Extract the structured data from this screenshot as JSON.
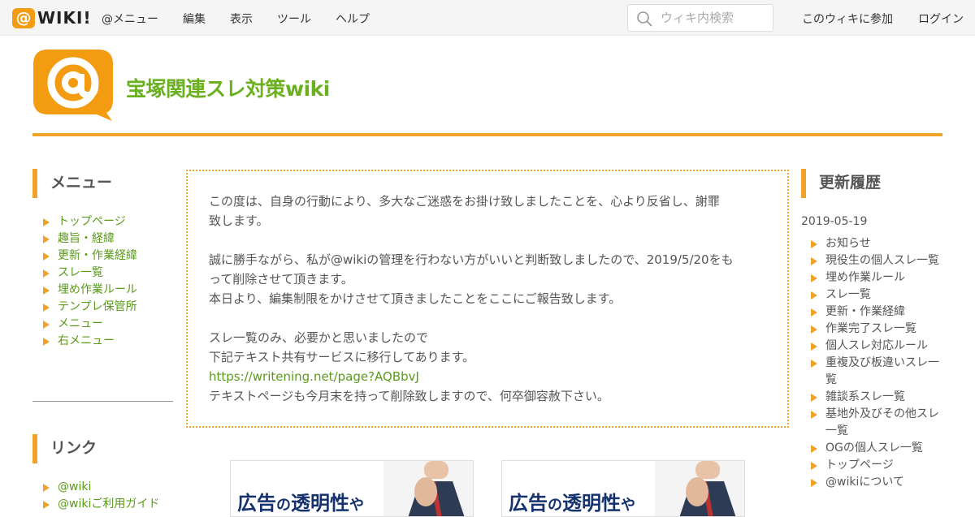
{
  "topnav": {
    "logo_text": "WIKI!",
    "items": [
      "@メニュー",
      "編集",
      "表示",
      "ツール",
      "ヘルプ"
    ],
    "search_placeholder": "ウィキ内検索",
    "join": "このウィキに参加",
    "login": "ログイン"
  },
  "header": {
    "site_title": "宝塚関連スレ対策wiki"
  },
  "left_menu": {
    "title": "メニュー",
    "items": [
      "トップページ",
      "趣旨・経緯",
      "更新・作業経緯",
      "スレ一覧",
      "埋め作業ルール",
      "テンプレ保管所",
      "メニュー",
      "右メニュー"
    ]
  },
  "links": {
    "title": "リンク",
    "items": [
      "@wiki",
      "@wikiご利用ガイド"
    ]
  },
  "notice": {
    "lines": [
      "この度は、自身の行動により、多大なご迷惑をお掛け致しましたことを、心より反省し、謝罪",
      "致します。",
      "誠に勝手ながら、私が@wikiの管理を行わない方がいいと判断致しましたので、2019/5/20をも",
      "って削除させて頂きます。",
      "本日より、編集制限をかけさせて頂きましたことをここにご報告致します。",
      "スレ一覧のみ、必要かと思いましたので",
      "下記テキスト共有サービスに移行してあります。",
      "テキストページも今月末を持って削除致しますので、何卒御容赦下さい。"
    ],
    "link": "https://writening.net/page?AQBbvJ"
  },
  "ads": [
    {
      "text_a": "広告",
      "text_b": "の",
      "text_c": "透明性",
      "text_d": "や"
    },
    {
      "text_a": "広告",
      "text_b": "の",
      "text_c": "透明性",
      "text_d": "や"
    }
  ],
  "right_menu": {
    "title": "更新履歴",
    "date": "2019-05-19",
    "items": [
      "お知らせ",
      "現役生の個人スレ一覧",
      "埋め作業ルール",
      "スレ一覧",
      "更新・作業経緯",
      "作業完了スレ一覧",
      "個人スレ対応ルール",
      "重複及び板違いスレ一覧",
      "雑談系スレ一覧",
      "基地外及びその他スレ一覧",
      "OGの個人スレ一覧",
      "トップページ",
      "@wikiについて"
    ]
  },
  "colors": {
    "accent": "#eea22a",
    "title_green": "#6ab01f",
    "link_green": "#5a9a1a"
  }
}
